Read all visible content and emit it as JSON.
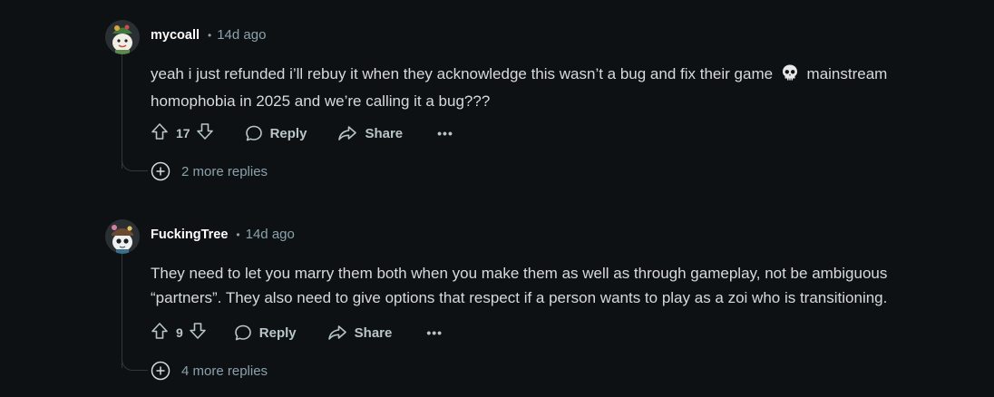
{
  "comments": [
    {
      "author": "mycoall",
      "time": "14d ago",
      "line1_before_emoji": "yeah i just refunded i’ll rebuy it when they acknowledge this wasn’t a bug and fix their game",
      "line1_after_emoji": "mainstream",
      "line2": "homophobia in 2025 and we’re calling it a bug???",
      "votes": "17",
      "reply_label": "Reply",
      "share_label": "Share",
      "more_label": "•••",
      "more_replies": "2 more replies"
    },
    {
      "author": "FuckingTree",
      "time": "14d ago",
      "line1": "They need to let you marry them both when you make them as well as through gameplay, not be ambiguous",
      "line2": "“partners”. They also need to give options that respect if a person wants to play as a zoi who is transitioning.",
      "votes": "9",
      "reply_label": "Reply",
      "share_label": "Share",
      "more_label": "•••",
      "more_replies": "4 more replies"
    }
  ],
  "meta_separator": "•",
  "icons": {
    "upvote": "arrow-up-outline-icon",
    "downvote": "arrow-down-outline-icon",
    "reply": "speech-bubble-icon",
    "share": "share-arrow-icon",
    "expand": "plus-circle-icon",
    "emoji": "skull-emoji-icon"
  },
  "colors": {
    "background": "#0e1113",
    "text": "#d7dadc",
    "muted": "#8ba2ad",
    "author": "#ffffff",
    "thread_line": "#343739"
  }
}
